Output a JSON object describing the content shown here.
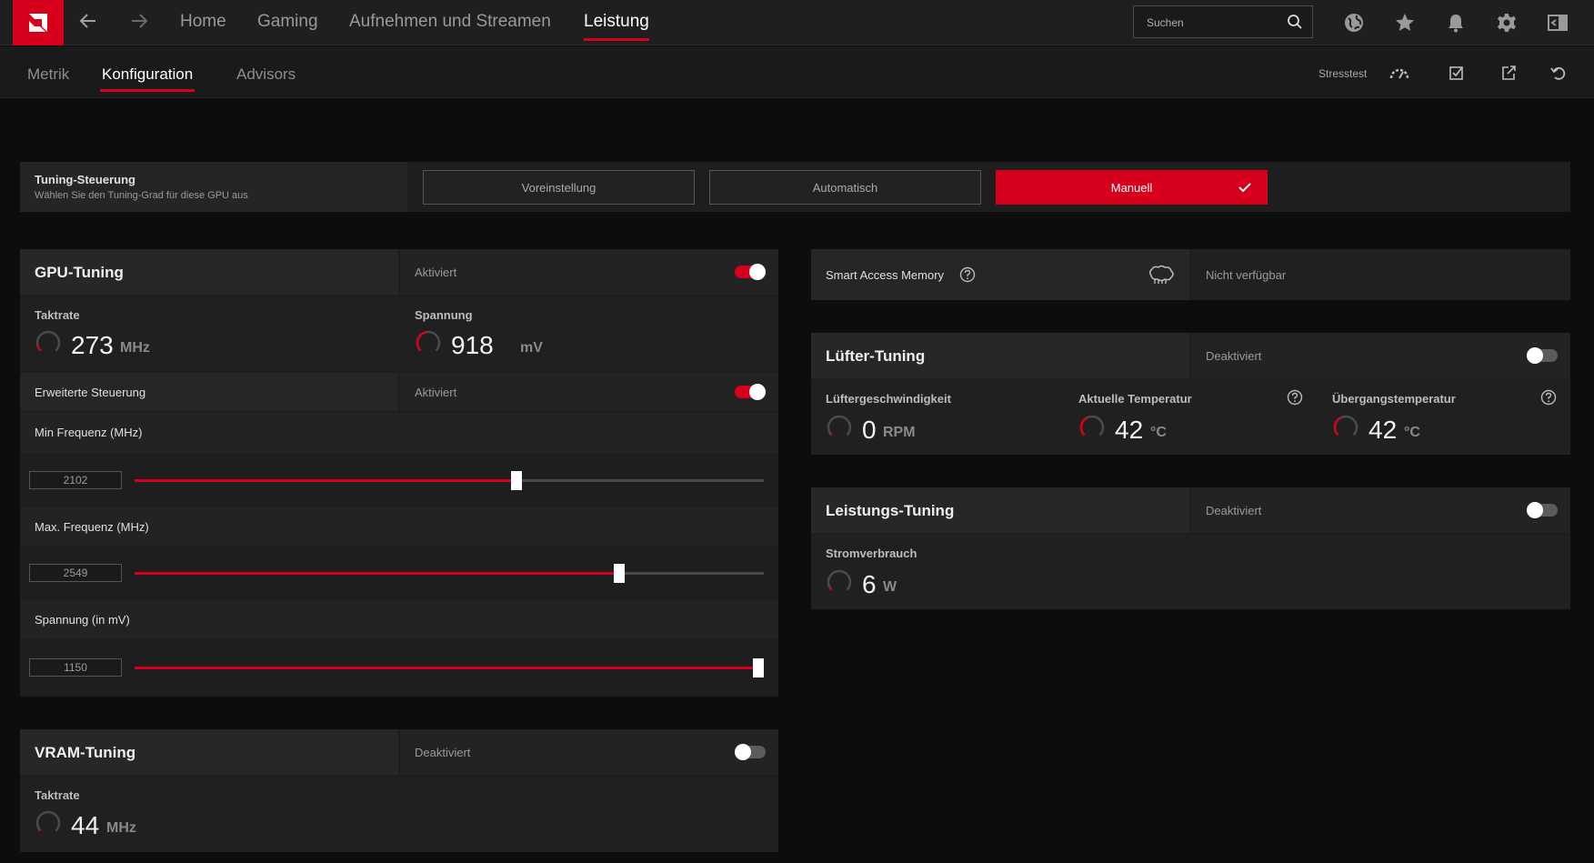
{
  "topnav": {
    "items": [
      "Home",
      "Gaming",
      "Aufnehmen und Streamen",
      "Leistung"
    ],
    "active": "Leistung"
  },
  "search": {
    "placeholder": "Suchen"
  },
  "subnav": {
    "items": [
      "Metrik",
      "Konfiguration",
      "Advisors"
    ],
    "active": "Konfiguration",
    "stresstest_label": "Stresstest"
  },
  "tuning_control": {
    "title": "Tuning-Steuerung",
    "subtitle": "Wählen Sie den Tuning-Grad für diese GPU aus",
    "options": [
      "Voreinstellung",
      "Automatisch",
      "Manuell"
    ],
    "selected": "Manuell"
  },
  "gpu_tuning": {
    "title": "GPU-Tuning",
    "state": "Aktiviert",
    "enabled": true,
    "clock": {
      "label": "Taktrate",
      "value": "273",
      "unit": "MHz",
      "gauge_fraction": 0.12
    },
    "voltage": {
      "label": "Spannung",
      "value": "918",
      "unit": "mV",
      "gauge_fraction": 0.45
    },
    "advanced": {
      "label": "Erweiterte Steuerung",
      "state": "Aktiviert",
      "enabled": true
    },
    "min_freq": {
      "label": "Min Frequenz (MHz)",
      "value": "2102",
      "slider_fraction": 0.607
    },
    "max_freq": {
      "label": "Max. Frequenz (MHz)",
      "value": "2549",
      "slider_fraction": 0.77
    },
    "voltage_slider": {
      "label": "Spannung (in mV)",
      "value": "1150",
      "slider_fraction": 1.0
    }
  },
  "vram_tuning": {
    "title": "VRAM-Tuning",
    "state": "Deaktiviert",
    "enabled": false,
    "clock": {
      "label": "Taktrate",
      "value": "44",
      "unit": "MHz",
      "gauge_fraction": 0.02
    }
  },
  "smart_access_memory": {
    "label": "Smart Access Memory",
    "status": "Nicht verfügbar"
  },
  "fan_tuning": {
    "title": "Lüfter-Tuning",
    "state": "Deaktiviert",
    "enabled": false,
    "fan_speed": {
      "label": "Lüftergeschwindigkeit",
      "value": "0",
      "unit": "RPM",
      "gauge_fraction": 0.0
    },
    "current_temp": {
      "label": "Aktuelle Temperatur",
      "value": "42",
      "unit": "°C",
      "gauge_fraction": 0.4
    },
    "junction_temp": {
      "label": "Übergangstemperatur",
      "value": "42",
      "unit": "°C",
      "gauge_fraction": 0.4
    }
  },
  "power_tuning": {
    "title": "Leistungs-Tuning",
    "state": "Deaktiviert",
    "enabled": false,
    "power": {
      "label": "Stromverbrauch",
      "value": "6",
      "unit": "W",
      "gauge_fraction": 0.05
    }
  },
  "colors": {
    "accent": "#d6001c",
    "background": "#0d0d0d",
    "panel": "#1e1e1e"
  }
}
